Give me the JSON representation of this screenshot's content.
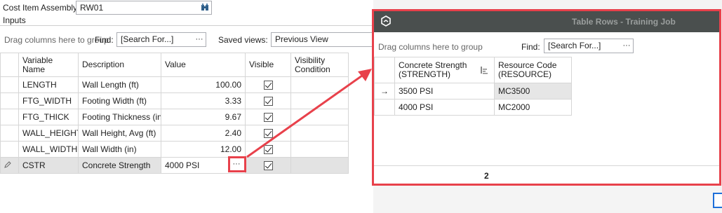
{
  "assembly": {
    "label": "Cost Item Assembly:",
    "value": "RW01",
    "lookup_icon": "binoculars-icon"
  },
  "inputs": {
    "title": "Inputs",
    "group_hint": "Drag columns here to group",
    "find_label": "Find:",
    "find_placeholder": "[Search For...]",
    "find_button": "···",
    "saved_views_label": "Saved views:",
    "saved_views_value": "Previous View",
    "columns": {
      "variable_name": "Variable\nName",
      "description": "Description",
      "value": "Value",
      "visible": "Visible",
      "visibility_condition": "Visibility\nCondition"
    },
    "rows": [
      {
        "name": "LENGTH",
        "description": "Wall Length (ft)",
        "value": "100.00",
        "visible": true
      },
      {
        "name": "FTG_WIDTH",
        "description": "Footing Width (ft)",
        "value": "3.33",
        "visible": true
      },
      {
        "name": "FTG_THICK",
        "description": "Footing Thickness (in)",
        "value": "9.67",
        "visible": true
      },
      {
        "name": "WALL_HEIGHT",
        "description": "Wall Height, Avg (ft)",
        "value": "2.40",
        "visible": true
      },
      {
        "name": "WALL_WIDTH",
        "description": "Wall Width (in)",
        "value": "12.00",
        "visible": true
      },
      {
        "name": "CSTR",
        "description": "Concrete Strength",
        "value": "4000 PSI",
        "visible": true,
        "editing": true,
        "ellipsis": "···"
      }
    ],
    "edit_icon": "pencil-icon"
  },
  "dialog": {
    "title": "Table Rows - Training Job",
    "logo_icon": "app-logo-icon",
    "group_hint": "Drag columns here to group",
    "find_label": "Find:",
    "find_placeholder": "[Search For...]",
    "find_button": "···",
    "columns": {
      "strength": "Concrete Strength\n(STRENGTH)",
      "resource": "Resource Code\n(RESOURCE)"
    },
    "rows": [
      {
        "strength": "3500 PSI",
        "resource": "MC3500",
        "current": true
      },
      {
        "strength": "4000 PSI",
        "resource": "MC2000",
        "current": false
      }
    ],
    "row_pointer": "→",
    "footer_count": "2",
    "accent_color": "#e8414b",
    "titlebar_color": "#4a4f4e"
  }
}
